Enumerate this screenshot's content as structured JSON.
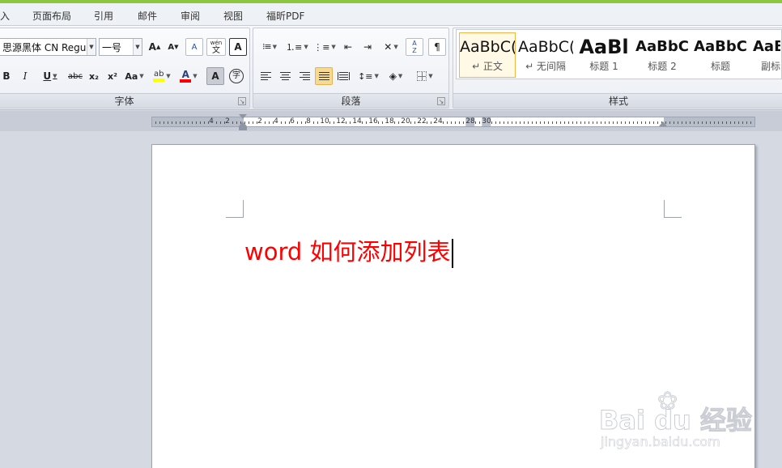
{
  "colors": {
    "accent_stripe": "#8cc63f",
    "doc_text": "#ff0000",
    "active_style_border": "#f0b646",
    "highlight_swatch": "#ffff00",
    "font_color_swatch": "#ff0000"
  },
  "menu": {
    "items": [
      "入",
      "页面布局",
      "引用",
      "邮件",
      "审阅",
      "视图",
      "福昕PDF"
    ]
  },
  "font_group": {
    "label": "字体",
    "font_name": "思源黑体 CN Regul",
    "font_size": "一号",
    "buttons": {
      "grow": "A",
      "shrink": "A",
      "clear": "A",
      "pinyin": "wén",
      "pinyin_char": "文",
      "border_char": "A",
      "bold": "B",
      "italic": "I",
      "underline": "U",
      "strike": "abc",
      "subscript": "x₂",
      "superscript": "x²",
      "change_case": "Aa",
      "highlight": "ab",
      "font_color": "A",
      "shading": "A",
      "enclose": "字"
    }
  },
  "paragraph_group": {
    "label": "段落",
    "sort_top": "A",
    "sort_bottom": "Z"
  },
  "styles_group": {
    "label": "样式",
    "items": [
      {
        "preview": "AaBbC(",
        "name": "↵ 正文"
      },
      {
        "preview": "AaBbC(",
        "name": "↵ 无间隔"
      },
      {
        "preview": "AaBl",
        "name": "标题 1"
      },
      {
        "preview": "AaBbC",
        "name": "标题 2"
      },
      {
        "preview": "AaBbC",
        "name": "标题"
      },
      {
        "preview": "AaB",
        "name": "副标"
      }
    ]
  },
  "ruler": {
    "numbers": [
      "4",
      "2",
      "2",
      "4",
      "6",
      "8",
      "10",
      "12",
      "14",
      "16",
      "18",
      "20",
      "22",
      "24",
      "28",
      "30"
    ]
  },
  "document": {
    "text": "word 如何添加列表"
  },
  "watermark": {
    "main": "Bai du 经验",
    "sub": "jingyan.baidu.com"
  }
}
